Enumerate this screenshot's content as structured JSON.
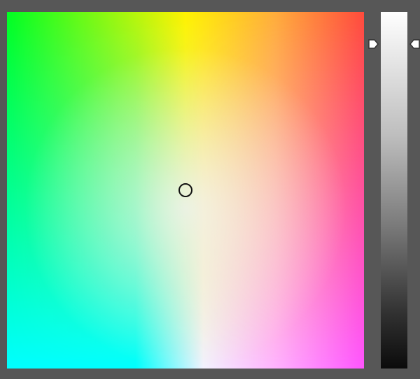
{
  "picker": {
    "field_colors": {
      "green": "#00ff22",
      "yellow": "#fff200",
      "orange": "#ffad3a",
      "red": "#ff4b3b",
      "cyan": "#00ffff",
      "white": "#f2f2ff",
      "pink": "#ffb3ff",
      "magenta": "#ff55ff"
    },
    "selected_saturation": 0.5,
    "selected_value_from_top": 0.5,
    "lightness_level": 0.91,
    "background_color": "#575757",
    "handle_fill": "#ffffff",
    "handle_stroke": "#333333",
    "ring_color": "#111111"
  }
}
